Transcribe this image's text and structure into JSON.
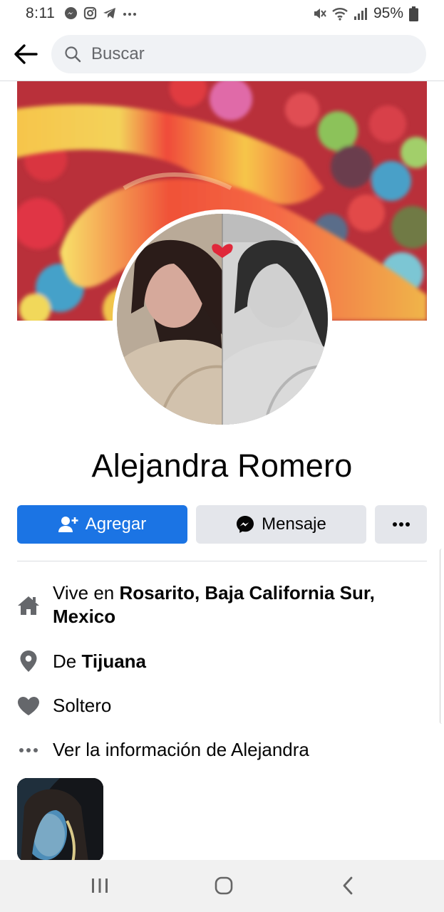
{
  "status_bar": {
    "time": "8:11",
    "left_icons": [
      "messenger-icon",
      "instagram-icon",
      "telegram-icon",
      "more-notifications-icon"
    ],
    "battery_percent": "95%",
    "right_icons": [
      "mute-icon",
      "wifi-icon",
      "signal-icon",
      "battery-icon"
    ]
  },
  "header": {
    "search_placeholder": "Buscar"
  },
  "profile": {
    "name": "Alejandra Romero"
  },
  "actions": {
    "add_label": "Agregar",
    "message_label": "Mensaje"
  },
  "details": {
    "lives_prefix": "Vive en ",
    "lives_place": "Rosarito, Baja California Sur,",
    "lives_country": "Mexico",
    "from_prefix": "De ",
    "from_place": "Tijuana",
    "relationship": "Soltero",
    "see_info": "Ver la información de Alejandra"
  },
  "colors": {
    "accent": "#1b74e4",
    "button_gray": "#e4e6eb",
    "icon_gray": "#65676b",
    "search_bg": "#f0f2f5"
  }
}
